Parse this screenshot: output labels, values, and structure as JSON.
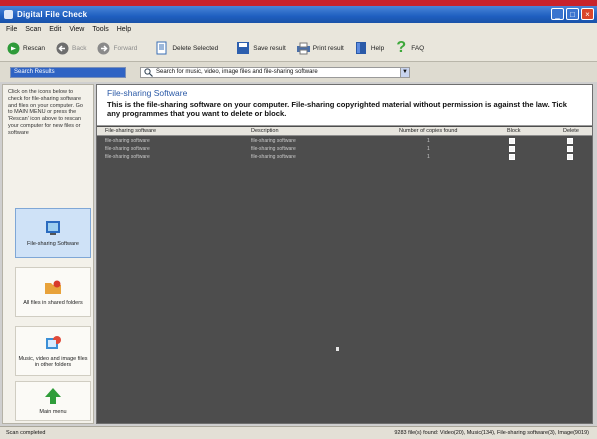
{
  "window": {
    "title": "Digital File Check"
  },
  "menu": [
    "File",
    "Scan",
    "Edit",
    "View",
    "Tools",
    "Help"
  ],
  "toolbar": {
    "rescan": "Rescan",
    "back": "Back",
    "forward": "Forward",
    "delete_selected": "Delete Selected",
    "save_result": "Save result",
    "print_result": "Print result",
    "help": "Help",
    "faq": "FAQ"
  },
  "search": {
    "input_value": "Search Results",
    "combo_value": "Search for music, video, image files and file-sharing software"
  },
  "sidebar": {
    "help_text": "Click on the icons below to check for file-sharing software and files on your computer. Go to MAIN MENU or press the 'Rescan' icon above to rescan your computer for new files or software",
    "items": [
      {
        "label": "File-sharing Software",
        "icon": "file-sharing-software-icon"
      },
      {
        "label": "All files in shared folders",
        "icon": "shared-folders-icon"
      },
      {
        "label": "Music, video and image files in other folders",
        "icon": "media-files-icon"
      },
      {
        "label": "Main menu",
        "icon": "main-menu-icon"
      }
    ]
  },
  "panel": {
    "title": "File-sharing Software",
    "description": "This is the file-sharing software on your computer. File-sharing copyrighted material without permission is against the law. Tick any programmes that you want to delete or block.",
    "columns": [
      "File-sharing software",
      "Description",
      "Number of copies found",
      "Block",
      "Delete"
    ],
    "rows": [
      {
        "name": "file-sharing software",
        "desc": "file-sharing software",
        "count": "1"
      },
      {
        "name": "file-sharing software",
        "desc": "file-sharing software",
        "count": "1"
      },
      {
        "name": "file-sharing software",
        "desc": "file-sharing software",
        "count": "1"
      }
    ]
  },
  "status": {
    "left": "Scan completed",
    "right": "9283 file(s) found: Video(20), Music(134), File-sharing software(3), Image(9019)"
  },
  "colors": {
    "titlebar": "#1f5fc0",
    "accent_red": "#c8232c",
    "panel_bg": "#4d4d4d"
  }
}
